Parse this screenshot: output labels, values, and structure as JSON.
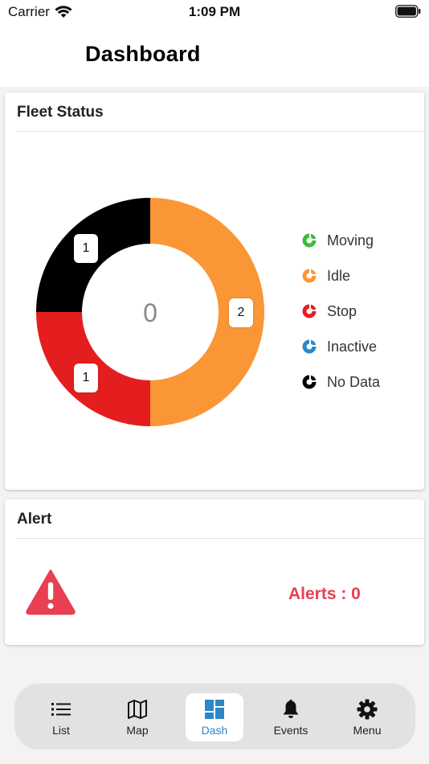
{
  "status_bar": {
    "carrier": "Carrier",
    "time": "1:09 PM"
  },
  "header": {
    "title": "Dashboard"
  },
  "fleet": {
    "title": "Fleet Status",
    "center_value": "0",
    "segments": [
      {
        "status": "Idle",
        "value": 2,
        "color": "#fb9637"
      },
      {
        "status": "Stop",
        "value": 1,
        "color": "#e41e1e"
      },
      {
        "status": "No Data",
        "value": 1,
        "color": "#000000"
      }
    ],
    "labels": {
      "idle": "2",
      "stop": "1",
      "no_data": "1"
    },
    "legend": [
      {
        "label": "Moving",
        "color": "#3bbd3b"
      },
      {
        "label": "Idle",
        "color": "#fb9637"
      },
      {
        "label": "Stop",
        "color": "#e41e1e"
      },
      {
        "label": "Inactive",
        "color": "#2b87c8"
      },
      {
        "label": "No Data",
        "color": "#000000"
      }
    ]
  },
  "alert": {
    "title": "Alert",
    "text": "Alerts : 0",
    "color": "#e83f52"
  },
  "tabs": [
    {
      "label": "List",
      "icon": "list-icon"
    },
    {
      "label": "Map",
      "icon": "map-icon"
    },
    {
      "label": "Dash",
      "icon": "dashboard-icon",
      "active": true
    },
    {
      "label": "Events",
      "icon": "bell-icon"
    },
    {
      "label": "Menu",
      "icon": "gear-icon"
    }
  ]
}
